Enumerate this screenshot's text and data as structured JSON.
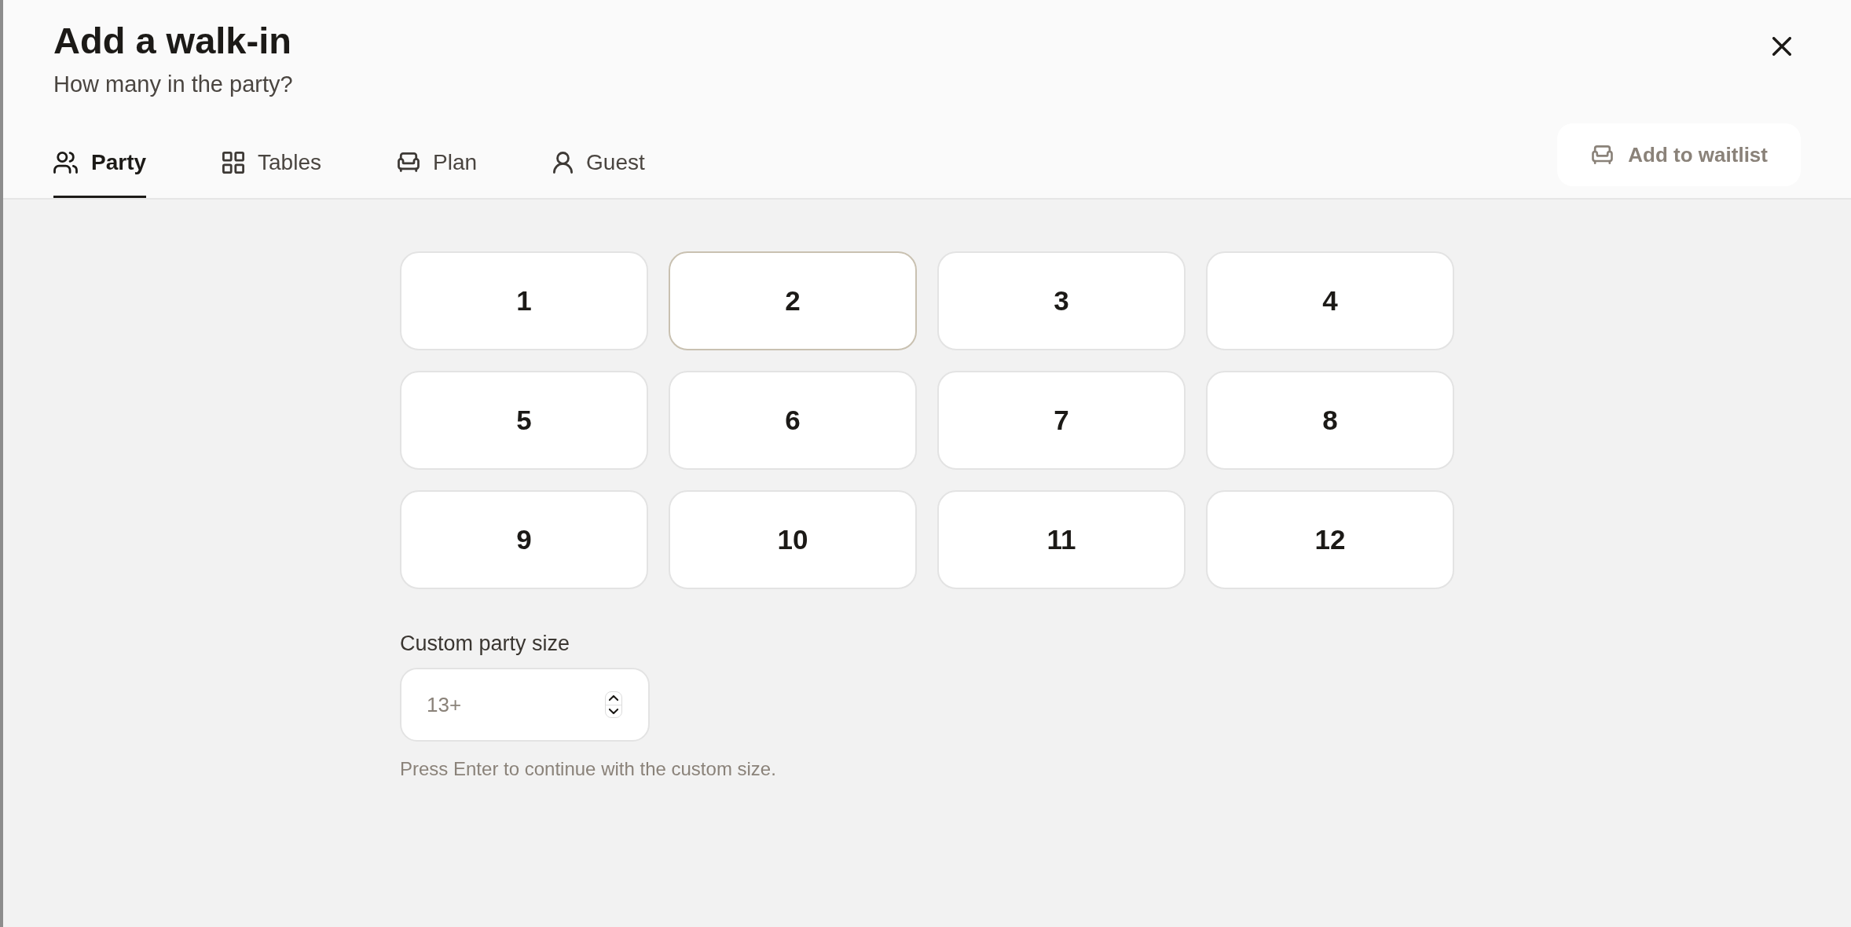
{
  "dialog": {
    "title": "Add a walk-in",
    "subtitle": "How many in the party?"
  },
  "tabs": [
    {
      "label": "Party",
      "selected": true
    },
    {
      "label": "Tables",
      "selected": false
    },
    {
      "label": "Plan",
      "selected": false
    },
    {
      "label": "Guest",
      "selected": false
    }
  ],
  "waitlist_button": {
    "label": "Add to waitlist",
    "disabled": true
  },
  "party_sizes": [
    {
      "label": "1",
      "selected": false
    },
    {
      "label": "2",
      "selected": true
    },
    {
      "label": "3",
      "selected": false
    },
    {
      "label": "4",
      "selected": false
    },
    {
      "label": "5",
      "selected": false
    },
    {
      "label": "6",
      "selected": false
    },
    {
      "label": "7",
      "selected": false
    },
    {
      "label": "8",
      "selected": false
    },
    {
      "label": "9",
      "selected": false
    },
    {
      "label": "10",
      "selected": false
    },
    {
      "label": "11",
      "selected": false
    },
    {
      "label": "12",
      "selected": false
    }
  ],
  "custom_size": {
    "label": "Custom party size",
    "placeholder": "13+",
    "hint": "Press Enter to continue with the custom size."
  }
}
